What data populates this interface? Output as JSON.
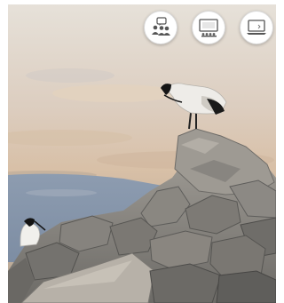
{
  "scene": {
    "subject": "seabirds-on-rocks",
    "colors": {
      "sky_top": "#e9e1d6",
      "sky_mid": "#dcc4ac",
      "haze": "#c6b4a2",
      "water": "#8796aa",
      "rock": "#8f8d89",
      "rock_dark": "#5e5d5b",
      "bird_white": "#f0efec",
      "bird_black": "#141414"
    }
  },
  "controls": {
    "items": [
      {
        "id": "group-meeting",
        "icon": "group-meeting-icon"
      },
      {
        "id": "audience-view",
        "icon": "audience-screen-icon"
      },
      {
        "id": "laptop-view",
        "icon": "laptop-icon"
      }
    ],
    "accent": "#555555"
  }
}
